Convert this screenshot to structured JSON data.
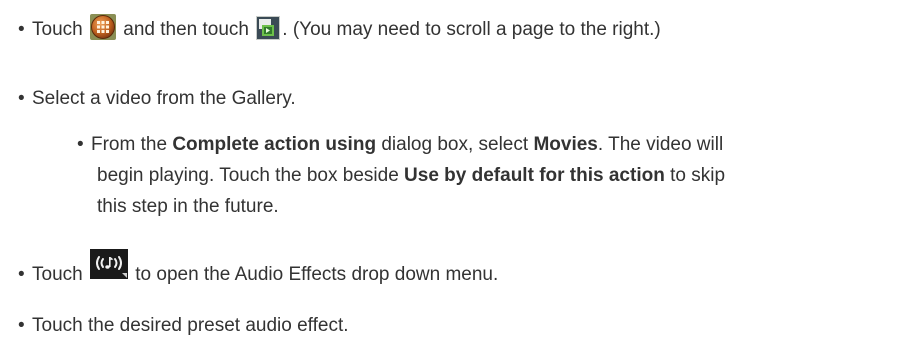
{
  "steps": [
    {
      "text_1": "Touch",
      "icon_1": "apps-grid-icon",
      "text_2": "and then touch",
      "icon_2": "movies-app-icon",
      "text_3": ". (You may need to scroll a page to the right.)"
    },
    {
      "text": "Select a video from the Gallery."
    },
    {
      "line1_pre": "From the",
      "line1_bold1": "Complete action using",
      "line1_mid": "dialog box, select",
      "line1_bold2": "Movies",
      "line1_post": ". The video will",
      "line2_pre": "begin playing. Touch the box beside",
      "line2_bold": "Use by default for this action",
      "line2_post": "to skip",
      "line3": "this step in the future."
    },
    {
      "text_1": "Touch",
      "icon": "audio-effects-icon",
      "text_2": "to open the Audio Effects drop down menu."
    },
    {
      "text": "Touch the desired preset audio effect."
    }
  ],
  "bullet": "•",
  "colors": {
    "text": "#333333",
    "apps_icon": "#b55a1e",
    "movies_icon_bg": "#3a4a55",
    "movies_icon_fg": "#6cc04a",
    "audio_icon_bg": "#1a1a1a"
  }
}
